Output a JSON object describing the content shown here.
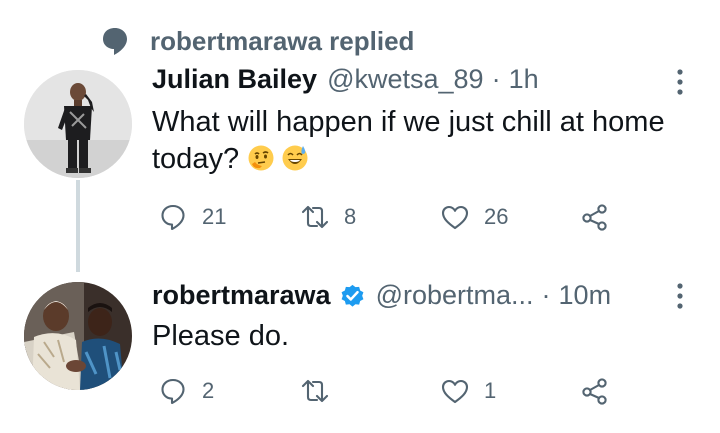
{
  "context": {
    "text": "robertmarawa replied",
    "icon": "speech-bubble-icon"
  },
  "tweets": [
    {
      "display_name": "Julian Bailey",
      "handle": "@kwetsa_89",
      "separator": "·",
      "time": "1h",
      "verified": false,
      "text": "What will happen if we just chill at home today?",
      "emojis": [
        "thinking-face-emoji",
        "grinning-sweat-emoji"
      ],
      "actions": {
        "reply": "21",
        "retweet": "8",
        "like": "26",
        "share": ""
      }
    },
    {
      "display_name": "robertmarawa",
      "handle": "@robertma...",
      "separator": "·",
      "time": "10m",
      "verified": true,
      "text": "Please do.",
      "actions": {
        "reply": "2",
        "retweet": "",
        "like": "1",
        "share": ""
      }
    }
  ],
  "colors": {
    "secondary_text": "#536471",
    "verified_blue": "#1d9bf0",
    "thread_line": "#cfd9de"
  }
}
